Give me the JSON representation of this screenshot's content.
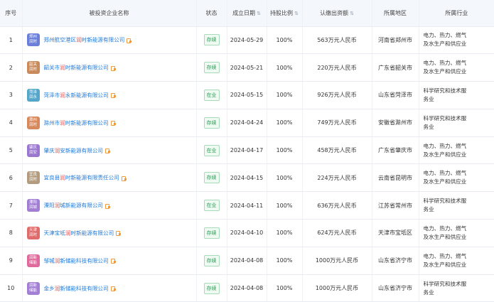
{
  "headers": {
    "index": "序号",
    "company": "被投资企业名称",
    "status": "状态",
    "date": "成立日期",
    "ratio": "持股比例",
    "capital": "认缴出资额",
    "region": "所属地区",
    "industry": "所属行业"
  },
  "rows": [
    {
      "index": "1",
      "logo": "郑州\n润时",
      "logo_color": "#6c7fd8",
      "name_pre": "郑州航空港区",
      "name_hl": "润",
      "name_post": "时新能源有限公司",
      "status": "存续",
      "date": "2024-05-29",
      "ratio": "100%",
      "capital": "563万元人民币",
      "region": "河南省郑州市",
      "industry": "电力、热力、燃气\n及水生产和供应业"
    },
    {
      "index": "2",
      "logo": "韶关\n润时",
      "logo_color": "#c98a5c",
      "name_pre": "韶关市",
      "name_hl": "润",
      "name_post": "时新能源有限公司",
      "status": "存续",
      "date": "2024-05-21",
      "ratio": "100%",
      "capital": "220万元人民币",
      "region": "广东省韶关市",
      "industry": "电力、热力、燃气\n及水生产和供应业"
    },
    {
      "index": "3",
      "logo": "菏泽\n润永",
      "logo_color": "#55a6c9",
      "name_pre": "菏泽市",
      "name_hl": "润",
      "name_post": "永新能源有限公司",
      "status": "在业",
      "date": "2024-05-15",
      "ratio": "100%",
      "capital": "926万元人民币",
      "region": "山东省菏泽市",
      "industry": "科学研究和技术服\n务业"
    },
    {
      "index": "4",
      "logo": "滁州\n润时",
      "logo_color": "#d7895d",
      "name_pre": "滁州市",
      "name_hl": "润",
      "name_post": "时新能源有限公司",
      "status": "存续",
      "date": "2024-04-24",
      "ratio": "100%",
      "capital": "749万元人民币",
      "region": "安徽省滁州市",
      "industry": "科学研究和技术服\n务业"
    },
    {
      "index": "5",
      "logo": "肇庆\n润安",
      "logo_color": "#9a78cf",
      "name_pre": "肇庆",
      "name_hl": "润",
      "name_post": "安新能源有限公司",
      "status": "在业",
      "date": "2024-04-17",
      "ratio": "100%",
      "capital": "458万元人民币",
      "region": "广东省肇庆市",
      "industry": "电力、热力、燃气\n及水生产和供应业"
    },
    {
      "index": "6",
      "logo": "宜良\n润时",
      "logo_color": "#b39b80",
      "name_pre": "宜良县",
      "name_hl": "润",
      "name_post": "时新能源有限责任公司",
      "status": "存续",
      "date": "2024-04-15",
      "ratio": "100%",
      "capital": "224万元人民币",
      "region": "云南省昆明市",
      "industry": "电力、热力、燃气\n及水生产和供应业"
    },
    {
      "index": "7",
      "logo": "溧阳\n润城",
      "logo_color": "#a27ed3",
      "name_pre": "溧阳",
      "name_hl": "润",
      "name_post": "城新能源有限公司",
      "status": "在业",
      "date": "2024-04-11",
      "ratio": "100%",
      "capital": "636万元人民币",
      "region": "江苏省常州市",
      "industry": "科学研究和技术服\n务业"
    },
    {
      "index": "8",
      "logo": "天津\n润时",
      "logo_color": "#e06b6b",
      "name_pre": "天津宝坻",
      "name_hl": "润",
      "name_post": "时新能源有限公司",
      "status": "存续",
      "date": "2024-04-10",
      "ratio": "100%",
      "capital": "624万元人民币",
      "region": "天津市宝坻区",
      "industry": "电力、热力、燃气\n及水生产和供应业"
    },
    {
      "index": "9",
      "logo": "润新\n储能",
      "logo_color": "#de6b9c",
      "name_pre": "邹城",
      "name_hl": "润",
      "name_post": "新储能科技有限公司",
      "status": "存续",
      "date": "2024-04-08",
      "ratio": "100%",
      "capital": "1000万元人民币",
      "region": "山东省济宁市",
      "industry": "电力、热力、燃气\n及水生产和供应业"
    },
    {
      "index": "10",
      "logo": "润新\n储能",
      "logo_color": "#a37ed5",
      "name_pre": "金乡",
      "name_hl": "润",
      "name_post": "新储能科技有限公司",
      "status": "存续",
      "date": "2024-04-08",
      "ratio": "100%",
      "capital": "1000万元人民币",
      "region": "山东省济宁市",
      "industry": "科学研究和技术服\n务业"
    }
  ]
}
